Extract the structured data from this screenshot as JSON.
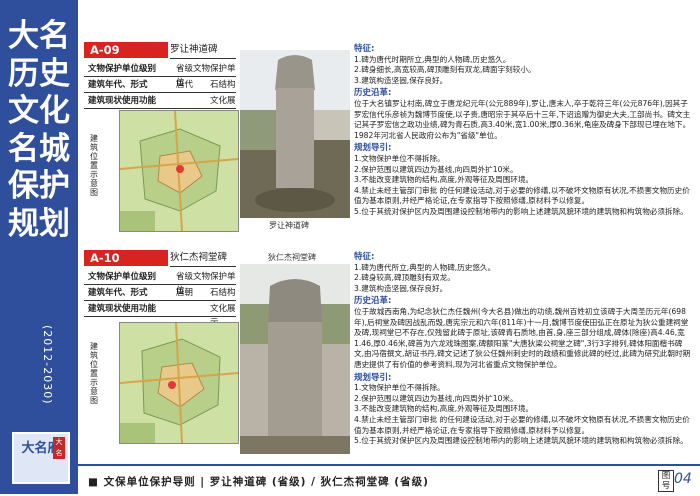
{
  "sidebar": {
    "title": "大名历史文化名城保护规划",
    "years": "(2012-2030)",
    "logo_text": "大名府",
    "logo_stamp": "大名"
  },
  "footer": {
    "text": "■  文保单位保护导则 | 罗让神道碑 (省级) / 狄仁杰祠堂碑 (省级)",
    "tuhao_label": "图号",
    "page_number": "04"
  },
  "sections": [
    {
      "id": "A-09",
      "name": "罗让神道碑",
      "rows": [
        {
          "k": "文物保护单位级别",
          "v1": "省级文物保护单位",
          "v2": ""
        },
        {
          "k": "建筑年代、形式",
          "v1": "唐代",
          "v2": "石结构"
        },
        {
          "k": "建筑现状使用功能",
          "v1": "",
          "v2": "文化展示"
        }
      ],
      "map_caption": "建筑位置示意图",
      "photo_caption": "罗让神道碑",
      "features_h": "特征:",
      "features": [
        "1.碑为唐代时期所立,典型的人物碑,历史悠久。",
        "2.碑身细长,高宽较高,碑顶雕刻有双龙,碑面字刻较小。",
        "3.建筑构造坚固,保存良好。"
      ],
      "history_h": "历史沿革:",
      "history": "位于大名镇罗让村南,碑立于唐龙纪元年(公元889年),罗让,唐末人,卒于乾符三年(公元876年),因其子罗宏信代乐彦祯为魏博节度使,以子贵,唐昭宗于其卒后十三年,下诏追赠为御史大夫,工部尚书。碑文主记其子罗宏信之政功业绩,碑为青石质,高3.40米,宽1.00米,厚0.36米,龟座及碑身下部现已埋在地下。1982年河北省人民政府公布为\"省级\"单位。",
      "guide_h": "规划导引:",
      "guide": [
        "1.文物保护单位不得拆除。",
        "2.保护范围以建筑四边为基线,向四周外扩10米。",
        "3.不能改变建筑物的结构,高度,外观等征及周围环境。",
        "4.禁止未经主管部门审批 的任何建设活动,对于必要的修缮,以不破坏文物原有状况,不损害文物历史价值为基本原则,并经严格论证,在专家指导下按照修缮,原材料予以修复。",
        "5.位于其统对保护区内及周围建设控制地带内的影响上述建筑风貌环境的建筑物和构筑物必须拆除。"
      ]
    },
    {
      "id": "A-10",
      "name": "狄仁杰祠堂碑",
      "rows": [
        {
          "k": "文物保护单位级别",
          "v1": "省级文物保护单位",
          "v2": ""
        },
        {
          "k": "建筑年代、形式",
          "v1": "唐朝",
          "v2": "石结构"
        },
        {
          "k": "建筑现状使用功能",
          "v1": "",
          "v2": "文化展示"
        }
      ],
      "map_caption": "建筑位置示意图",
      "photo_caption": "狄仁杰祠堂碑",
      "features_h": "特征:",
      "features": [
        "1.碑为唐代所立,典型的人物碑,历史悠久。",
        "2.碑身较高,碑顶雕刻有双龙。",
        "3.建筑构造坚固,保存良好。"
      ],
      "history_h": "历史沿革:",
      "history": "位于故城西南角,为纪念狄仁杰任魏州(今大名县)做出的功绩,魏州百姓初立该碑于大周圣历元年(698年),后祠堂及碑因战乱而毁,唐宪宗元和六年(811年)十一月,魏博节度使田弘正在原址为狄公重建祠堂及碑,现祠堂已不存在,仅残留此碑于原址,该碑青石质地,由首,身,座三部分组成,碑体(除座)高4.46,宽1.46,厚0.46米,碑首为六龙戏珠图案,碑额阳篆\"大唐狄梁公祠堂之碑\",3行3字排列,碑体阳面楷书碑文,由冯宿撰文,胡证书丹,碑文记述了狄公任魏州刺史时的政绩和重修此碑的经过,此碑为研究此朝时期唐史提供了有价值的参考资料,现为河北省重点文物保护单位。",
      "guide_h": "规划导引:",
      "guide": [
        "1.文物保护单位不得拆除。",
        "2.保护范围以建筑四边为基线,向四周外扩10米。",
        "3.不能改变建筑物的结构,高度,外观等征及周围环境。",
        "4.禁止未经主管部门审批 的任何建设活动,对于必要的修缮,以不破坏文物原有状况,不损害文物历史价值为基本原则,并经严格论证,在专家指导下按照修缮,原材料予以修复。",
        "5.位于其统对保护区内及周围建设控制地带内的影响上述建筑风貌环境的建筑物和构筑物必须拆除。"
      ]
    }
  ]
}
